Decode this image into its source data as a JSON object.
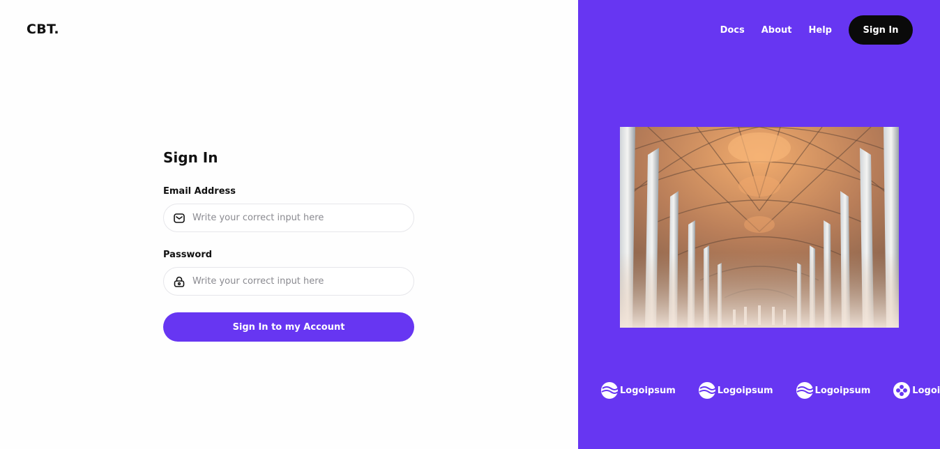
{
  "theme": {
    "accent": "#6736f2",
    "dark": "#0a0a0a"
  },
  "brand": {
    "name": "CBT."
  },
  "nav": {
    "links": [
      "Docs",
      "About",
      "Help"
    ],
    "signin_label": "Sign In"
  },
  "form": {
    "title": "Sign In",
    "email": {
      "label": "Email Address",
      "placeholder": "Write your correct input here",
      "value": "",
      "icon": "mail-icon"
    },
    "password": {
      "label": "Password",
      "placeholder": "Write your correct input here",
      "value": "",
      "icon": "lock-icon"
    },
    "submit_label": "Sign In to my Account"
  },
  "hero": {
    "image": "cathedral-vaulted-ceiling"
  },
  "partner_logos": [
    {
      "label": "Logoipsum",
      "icon": "waves-icon"
    },
    {
      "label": "Logoipsum",
      "icon": "waves-icon"
    },
    {
      "label": "Logoipsum",
      "icon": "waves-icon"
    },
    {
      "label": "Logoipsum",
      "icon": "clover-icon"
    }
  ]
}
